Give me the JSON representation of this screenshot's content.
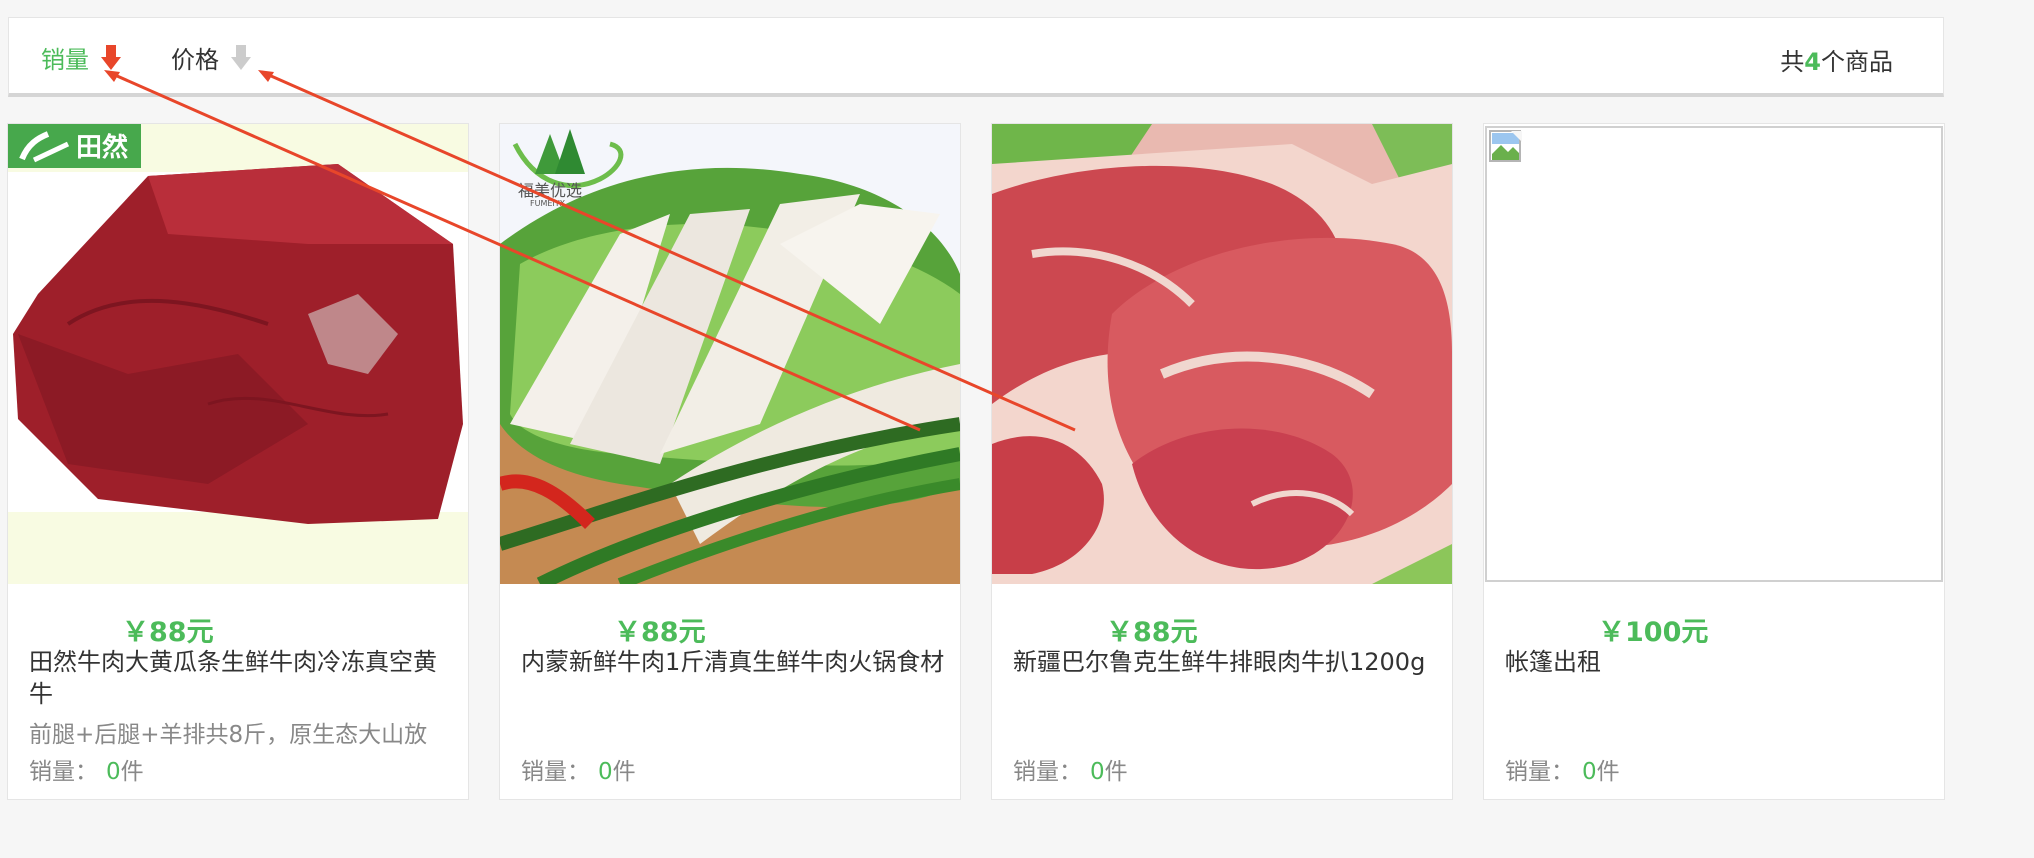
{
  "sort_bar": {
    "sales_label": "销量",
    "price_label": "价格",
    "total_prefix": "共",
    "total_count": "4",
    "total_suffix": "个商品",
    "active_color": "#4cbb5a",
    "active_arrow_color": "#e8462a",
    "inactive_arrow_color": "#cccccc"
  },
  "products": [
    {
      "price": "￥88元",
      "title": "田然牛肉大黄瓜条生鲜牛肉冷冻真空黄牛",
      "desc": "前腿+后腿+羊排共8斤，原生态大山放",
      "sales_label": "销量：",
      "sales_count": "0",
      "sales_unit": "件",
      "logo_text": "田然"
    },
    {
      "price": "￥88元",
      "title": "内蒙新鲜牛肉1斤清真生鲜牛肉火锅食材",
      "desc": "",
      "sales_label": "销量：",
      "sales_count": "0",
      "sales_unit": "件",
      "logo_text": "福美优选",
      "logo_subtext": "FUMEIYX"
    },
    {
      "price": "￥88元",
      "title": "新疆巴尔鲁克生鲜牛排眼肉牛扒1200g",
      "desc": "",
      "sales_label": "销量：",
      "sales_count": "0",
      "sales_unit": "件"
    },
    {
      "price": "￥100元",
      "title": "帐篷出租",
      "desc": "",
      "sales_label": "销量：",
      "sales_count": "0",
      "sales_unit": "件"
    }
  ]
}
